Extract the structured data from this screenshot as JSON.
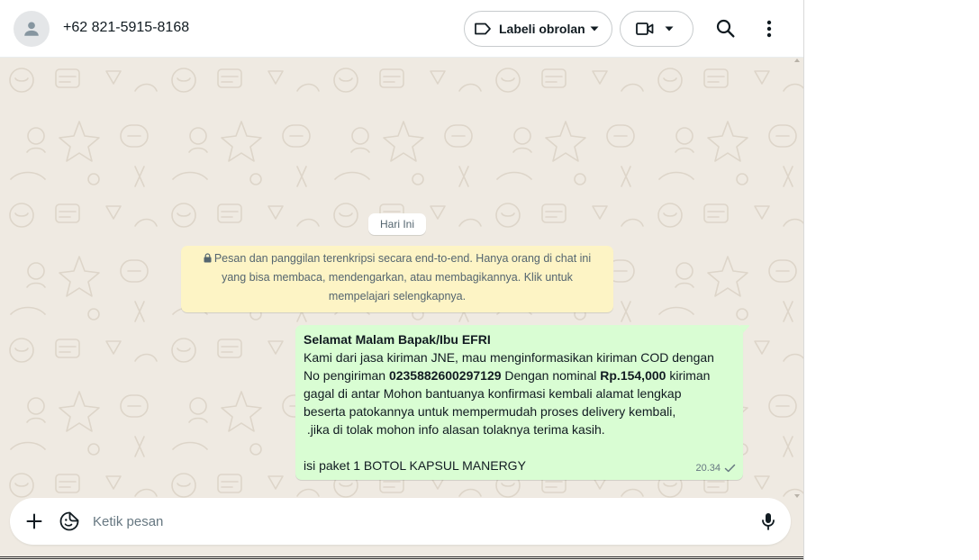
{
  "header": {
    "contact_name": "+62 821-5915-8168",
    "label_button": "Labeli obrolan"
  },
  "chat": {
    "day_chip": "Hari Ini",
    "encryption_notice": "Pesan dan panggilan terenkripsi secara end-to-end. Hanya orang di chat ini yang bisa membaca, mendengarkan, atau membagikannya. Klik untuk mempelajari selengkapnya.",
    "message": {
      "line1": "Selamat Malam Bapak/Ibu EFRI",
      "line2": "Kami dari jasa kiriman JNE, mau menginformasikan kiriman COD dengan",
      "line3_a": "No pengiriman ",
      "line3_tracking": "0235882600297129",
      "line3_b": " Dengan nominal ",
      "line3_amount": "Rp.154,000",
      "line3_c": " kiriman",
      "line4": "gagal di antar Mohon bantuanya konfirmasi kembali alamat lengkap",
      "line5": "beserta patokannya untuk mempermudah proses delivery kembali,",
      "line6": " .jika di tolak mohon info alasan tolaknya terima kasih.",
      "line7": "isi paket 1 BOTOL KAPSUL MANERGY",
      "time": "20.34"
    }
  },
  "composer": {
    "placeholder": "Ketik pesan"
  },
  "colors": {
    "chat_background": "#efeae2",
    "outgoing_bubble": "#d9fdd3",
    "encryption_notice_bg": "#fdf4c5",
    "icon_gray": "#54656f"
  },
  "icons": {
    "avatar": "person-icon",
    "label": "label-tag-icon",
    "video": "video-camera-icon",
    "search": "search-icon",
    "menu": "more-vertical-icon",
    "lock": "lock-icon",
    "check": "single-check-icon",
    "attach": "plus-icon",
    "sticker": "sticker-icon",
    "mic": "microphone-icon"
  }
}
